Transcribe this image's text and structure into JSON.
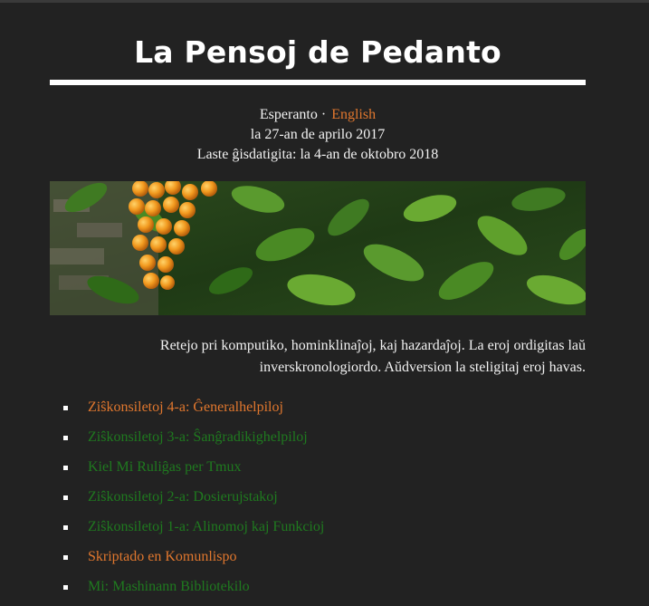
{
  "site": {
    "title": "La Pensoj de Pedanto"
  },
  "languages": {
    "current": "Esperanto",
    "separator": "·",
    "other": "English"
  },
  "dates": {
    "published": "la 27-an de aprilo 2017",
    "updated": "Laste ĝisdatigita: la 4-an de oktobro 2018"
  },
  "banner": {
    "icon": "orange-berries-foliage-photo"
  },
  "intro": {
    "line1": "Retejo pri komputiko, hominklinaĵoj, kaj hazardaĵoj. La eroj ordigitas laŭ",
    "line2": "inverskronologiordo. Aŭdversion la steligitaj eroj havas."
  },
  "colors": {
    "background": "#222222",
    "link_orange": "#e0772e",
    "link_green": "#1f7a1f",
    "text": "#f2f2f2"
  },
  "posts": [
    {
      "title": "Ziŝkonsiletoj 4-a: Ĝeneralhelpiloj",
      "color": "#e0772e"
    },
    {
      "title": "Ziŝkonsiletoj 3-a: Ŝanĝradikighelpiloj",
      "color": "#1f7a1f"
    },
    {
      "title": "Kiel Mi Ruliĝas per Tmux",
      "color": "#1f7a1f"
    },
    {
      "title": "Ziŝkonsiletoj 2-a: Dosierujstakoj",
      "color": "#1f7a1f"
    },
    {
      "title": "Ziŝkonsiletoj 1-a: Alinomoj kaj Funkcioj",
      "color": "#1f7a1f"
    },
    {
      "title": "Skriptado en Komunlispo",
      "color": "#e0772e"
    },
    {
      "title": "Mi: Mashinann Bibliotekilo",
      "color": "#1f7a1f"
    }
  ]
}
